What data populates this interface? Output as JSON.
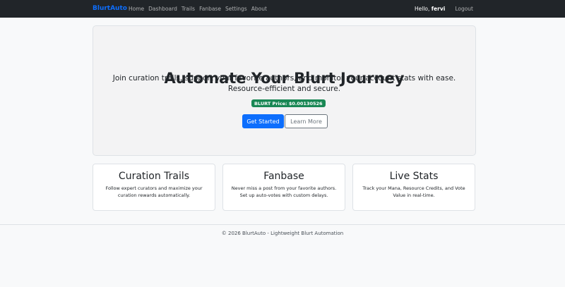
{
  "navbar": {
    "brand": "BlurtAuto",
    "links": [
      "Home",
      "Dashboard",
      "Trails",
      "Fanbase",
      "Settings",
      "About"
    ],
    "hello_prefix": "Hello, ",
    "username": "fervi",
    "logout": "Logout"
  },
  "hero": {
    "title": "Automate Your Blurt Journey",
    "lead": "Join curation trails, support your favorite authors, and monitor your account stats with ease. Resource-efficient and secure.",
    "price_badge": "BLURT Price: $0.00130526",
    "get_started": "Get Started",
    "learn_more": "Learn More"
  },
  "features": [
    {
      "title": "Curation Trails",
      "text": "Follow expert curators and maximize your curation rewards automatically."
    },
    {
      "title": "Fanbase",
      "text": "Never miss a post from your favorite authors. Set up auto-votes with custom delays."
    },
    {
      "title": "Live Stats",
      "text": "Track your Mana, Resource Credits, and Vote Value in real-time."
    }
  ],
  "footer": "© 2026 BlurtAuto - Lightweight Blurt Automation",
  "colors": {
    "navbar_bg": "#212529",
    "brand": "#0d6efd",
    "primary": "#0d6efd",
    "success_badge": "#198754"
  }
}
